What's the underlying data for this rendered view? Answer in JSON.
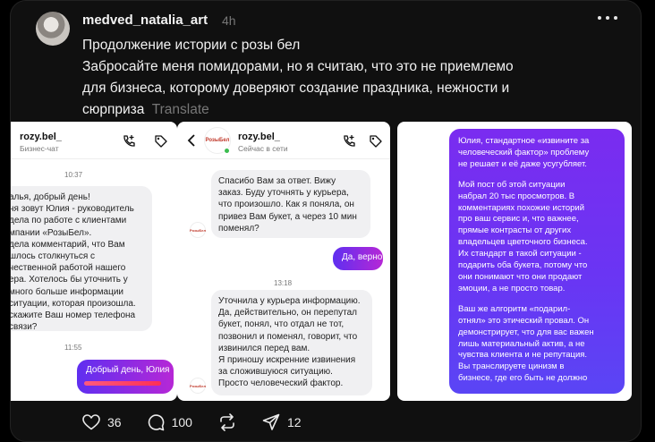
{
  "post": {
    "username": "medved_natalia_art",
    "time": "4h",
    "text_lines": [
      "Продолжение истории с розы бел",
      "Забросайте меня помидорами, но я считаю, что это не приемлемо",
      "для бизнеса, которому доверяют создание праздника, нежности и",
      "сюрприза"
    ],
    "translate_label": "Translate"
  },
  "screenshot1": {
    "name": "rozy.bel_",
    "subtitle": "Бизнес-чат",
    "time1": "10:37",
    "bubble_lines": [
      "алья, добрый день!",
      "ня зовут Юлия - руководитель",
      "дела по работе с клиентами",
      "мпании «РозыБел».",
      "дела комментарий, что Вам",
      "шлось столкнуться с",
      "чественной работой нашего",
      "ера. Хотелось бы уточнить у",
      "много больше информации",
      "ситуации, которая произошла.",
      "скажите Ваш номер телефона",
      "связи?"
    ],
    "time2": "11:55",
    "out_text": "Добрый день, Юлия"
  },
  "screenshot2": {
    "name": "rozy.bel_",
    "status": "Сейчас в сети",
    "msg1_lines": [
      "Спасибо Вам за ответ. Вижу",
      "заказ. Буду уточнять у курьера,",
      "что произошло. Как я поняла, он",
      "привез Вам букет, а через 10 мин",
      "поменял?"
    ],
    "out_text": "Да, верно",
    "time": "13:18",
    "msg2_lines": [
      "Уточнила у курьера информацию.",
      "Да, действительно, он перепутал",
      "букет, понял, что отдал не тот,",
      "позвонил и поменял, говорит, что",
      "извинился перед вам.",
      "Я приношу искренние извинения",
      "за сложившуюся ситуацию.",
      "Просто человеческий фактор."
    ],
    "logo_text": "РозыБел"
  },
  "screenshot3": {
    "para1": [
      "Юлия, стандартное «извините за",
      "человеческий фактор» проблему",
      "не решает и её даже усугубляет."
    ],
    "para2": [
      "Мой пост об этой ситуации",
      "набрал 20 тыс просмотров. В",
      "комментариях похожие историй",
      "про ваш сервис и, что важнее,",
      "прямые контрасты от других",
      "владельцев цветочного бизнеса.",
      "Их стандарт в такой ситуации -",
      "подарить оба букета, потому что",
      "они понимают что они продают",
      "эмоции, а не просто товар."
    ],
    "para3": [
      "Ваш же алгоритм «подарил-",
      "отнял» это этический провал. Он",
      "демонстрирует, что для вас важен",
      "лишь материальный актив, а не",
      "чувства клиента и не репутация.",
      "Вы транслируете цинизм в",
      "бизнесе, где его быть не должно"
    ]
  },
  "actions": {
    "likes": "36",
    "comments": "100",
    "shares": "12"
  }
}
